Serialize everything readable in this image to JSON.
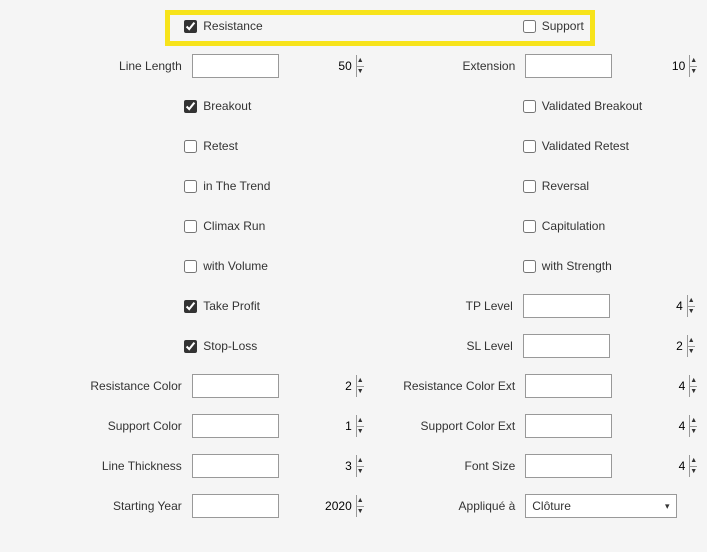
{
  "top": {
    "resistance": {
      "label": "Resistance",
      "checked": true
    },
    "support": {
      "label": "Support",
      "checked": false
    }
  },
  "line_length": {
    "label": "Line Length",
    "value": "50"
  },
  "extension": {
    "label": "Extension",
    "value": "10"
  },
  "opts_left": [
    {
      "label": "Breakout",
      "checked": true
    },
    {
      "label": "Retest",
      "checked": false
    },
    {
      "label": "in The Trend",
      "checked": false
    },
    {
      "label": "Climax Run",
      "checked": false
    },
    {
      "label": "with Volume",
      "checked": false
    },
    {
      "label": "Take Profit",
      "checked": true
    },
    {
      "label": "Stop-Loss",
      "checked": true
    }
  ],
  "opts_right": [
    {
      "label": "Validated Breakout",
      "checked": false
    },
    {
      "label": "Validated Retest",
      "checked": false
    },
    {
      "label": "Reversal",
      "checked": false
    },
    {
      "label": "Capitulation",
      "checked": false
    },
    {
      "label": "with Strength",
      "checked": false
    }
  ],
  "tp_level": {
    "label": "TP Level",
    "value": "4"
  },
  "sl_level": {
    "label": "SL Level",
    "value": "2"
  },
  "resistance_color": {
    "label": "Resistance Color",
    "value": "2"
  },
  "resistance_color_ext": {
    "label": "Resistance Color Ext",
    "value": "4"
  },
  "support_color": {
    "label": "Support Color",
    "value": "1"
  },
  "support_color_ext": {
    "label": "Support Color Ext",
    "value": "4"
  },
  "line_thickness": {
    "label": "Line Thickness",
    "value": "3"
  },
  "font_size": {
    "label": "Font Size",
    "value": "4"
  },
  "starting_year": {
    "label": "Starting Year",
    "value": "2020"
  },
  "applied_to": {
    "label": "Appliqué à",
    "value": "Clôture"
  }
}
